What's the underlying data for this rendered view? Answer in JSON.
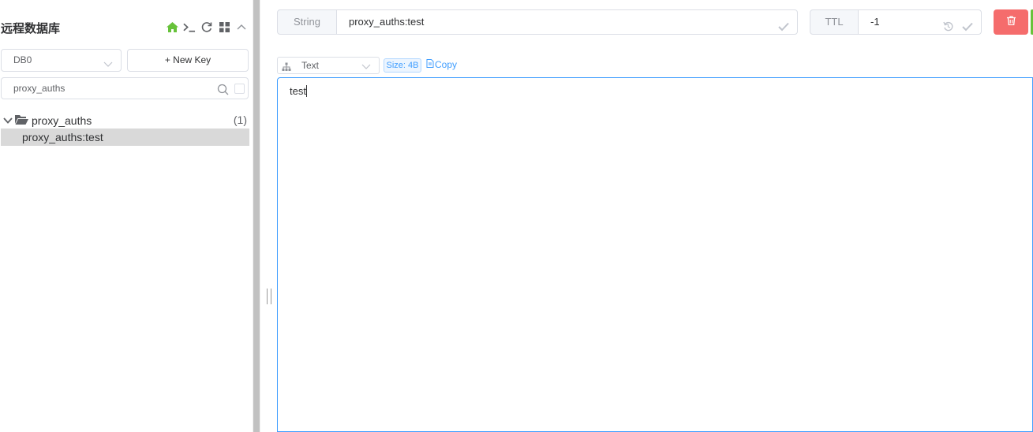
{
  "sidebar": {
    "connection_name": "远程数据库",
    "icons": [
      "home-icon",
      "terminal-icon",
      "refresh-icon",
      "grid-icon",
      "chevron-up-icon"
    ],
    "db_select": {
      "value": "DB0"
    },
    "new_key_label": "+ New Key",
    "search": {
      "value": "proxy_auths"
    },
    "tree": {
      "folder": {
        "label": "proxy_auths",
        "count": "(1)"
      },
      "items": [
        {
          "label": "proxy_auths:test",
          "selected": true
        }
      ]
    }
  },
  "key_header": {
    "type_label": "String",
    "key_name": "proxy_auths:test",
    "ttl_label": "TTL",
    "ttl_value": "-1"
  },
  "value_toolbar": {
    "format": "Text",
    "size_label": "Size: 4B",
    "copy_label": "Copy"
  },
  "editor": {
    "content": "test"
  },
  "colors": {
    "accent": "#409eff",
    "danger": "#f56c6c",
    "success": "#67c23a",
    "home_icon": "#67c23a"
  }
}
